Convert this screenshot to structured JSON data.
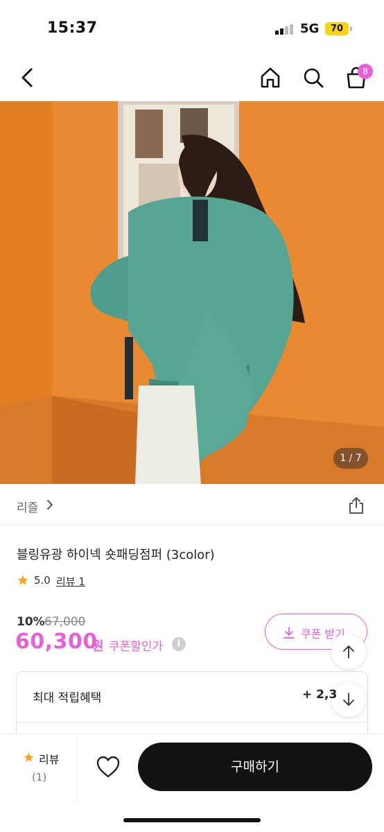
{
  "status_bar": {
    "time": "15:37",
    "network": "5G",
    "battery": "70"
  },
  "nav": {
    "cart_badge": "8"
  },
  "gallery": {
    "counter": "1 / 7"
  },
  "seller": {
    "name": "리즐"
  },
  "product": {
    "title": "블링유광 하이넥 숏패딩점퍼 (3color)",
    "rating": "5.0",
    "review_link": "리뷰 1"
  },
  "price": {
    "discount_rate": "10%",
    "original": "67,000",
    "sale": "60,300",
    "currency": "원",
    "coupon_label": "쿠폰할인가",
    "info_symbol": "i"
  },
  "coupon_button": {
    "label": "쿠폰 받기"
  },
  "benefit": {
    "label": "최대 적립혜택",
    "value": "+ 2,3"
  },
  "bottom_bar": {
    "review_label": "리뷰",
    "review_count": "(1)",
    "buy_label": "구매하기"
  },
  "colors": {
    "accent": "#e85fd8",
    "buy_button": "#121212",
    "battery": "#f7d511"
  },
  "icons": [
    "back-arrow-icon",
    "home-icon",
    "search-icon",
    "cart-icon",
    "share-icon",
    "star-icon",
    "download-icon",
    "arrow-up-icon",
    "arrow-down-icon",
    "heart-icon",
    "info-icon",
    "chevron-right-icon"
  ]
}
